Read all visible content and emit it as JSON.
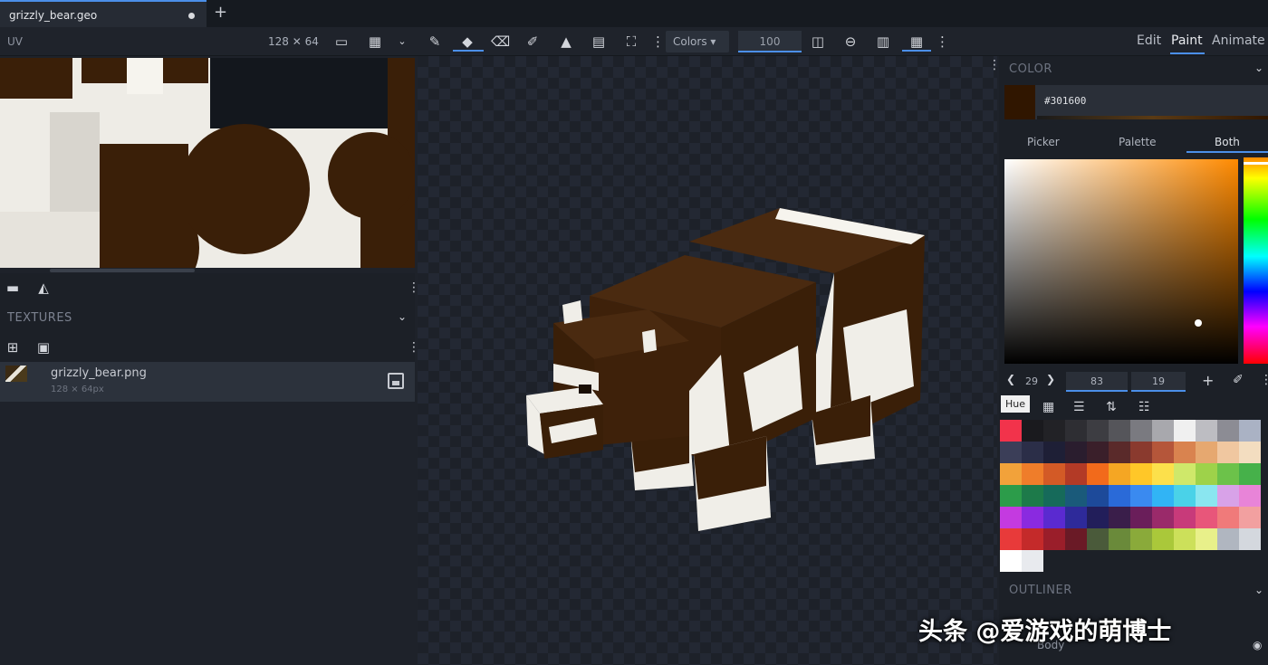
{
  "tab": {
    "title": "grizzly_bear.geo",
    "new_tab": "+"
  },
  "toolbar": {
    "uv_label": "UV",
    "uv_size": "128 ✕ 64",
    "colors_select": "Colors ▾",
    "brush_size": "100",
    "modes": [
      "Edit",
      "Paint",
      "Animate"
    ]
  },
  "textures": {
    "title": "TEXTURES",
    "items": [
      {
        "name": "grizzly_bear.png",
        "size": "128 × 64px"
      }
    ]
  },
  "color_panel": {
    "title": "COLOR",
    "hex": "#301600",
    "tabs": [
      "Picker",
      "Palette",
      "Both"
    ],
    "active_tab": "Both",
    "hue_value": "29",
    "sat_value": "83",
    "val_value": "19",
    "tooltip": "Hue"
  },
  "palette_colors": [
    [
      "#f2334b",
      "#1a1a1e",
      "#222226",
      "#2e2e33",
      "#3d3d42",
      "#55555a",
      "#7a7a80",
      "#a8a8ad",
      "#f0f0f0",
      "#bdbdc2",
      "#8c8c94",
      "#aab2c4"
    ],
    [
      "#3b3e58",
      "#2b2e48",
      "#1e1f36",
      "#2a1d2e",
      "#3a1f2a",
      "#5a2a2a",
      "#8a3a2e",
      "#b5563a",
      "#d9834f",
      "#e6a870",
      "#f0c7a0",
      "#f3ddc0"
    ],
    [
      "#f2a23a",
      "#ef7d2a",
      "#d35a26",
      "#b33a26",
      "#f26a1b",
      "#f5a623",
      "#ffc728",
      "#fce04b",
      "#cfe86a",
      "#9ed24a",
      "#6cc24a",
      "#46b14a"
    ],
    [
      "#2c9c4a",
      "#1d7a4a",
      "#166a5a",
      "#1a5a7a",
      "#1d4a9a",
      "#2a6ad8",
      "#3a8af0",
      "#31b4f5",
      "#4ad2e8",
      "#8ae6f0",
      "#d8a2e8",
      "#e884d8"
    ],
    [
      "#c43ae0",
      "#8a2ae0",
      "#5a2ad0",
      "#2e2a9a",
      "#221e5a",
      "#3a1e4a",
      "#6a1e5a",
      "#9a2a6a",
      "#c83a7a",
      "#e8567a",
      "#f07a7a",
      "#f2a0a0"
    ],
    [
      "#e83a3a",
      "#c42a2a",
      "#9a1e2a",
      "#6a1a26",
      "#4a5a3a",
      "#6a8a3a",
      "#8aaa3a",
      "#aac83a",
      "#cce05a",
      "#e8f08a",
      "#b0b6c0",
      "#d4d8de"
    ],
    [
      "#ffffff",
      "#e8eaee"
    ]
  ],
  "outliner": {
    "title": "OUTLINER",
    "item": "Body"
  },
  "watermark": "头条 @爱游戏的萌博士"
}
